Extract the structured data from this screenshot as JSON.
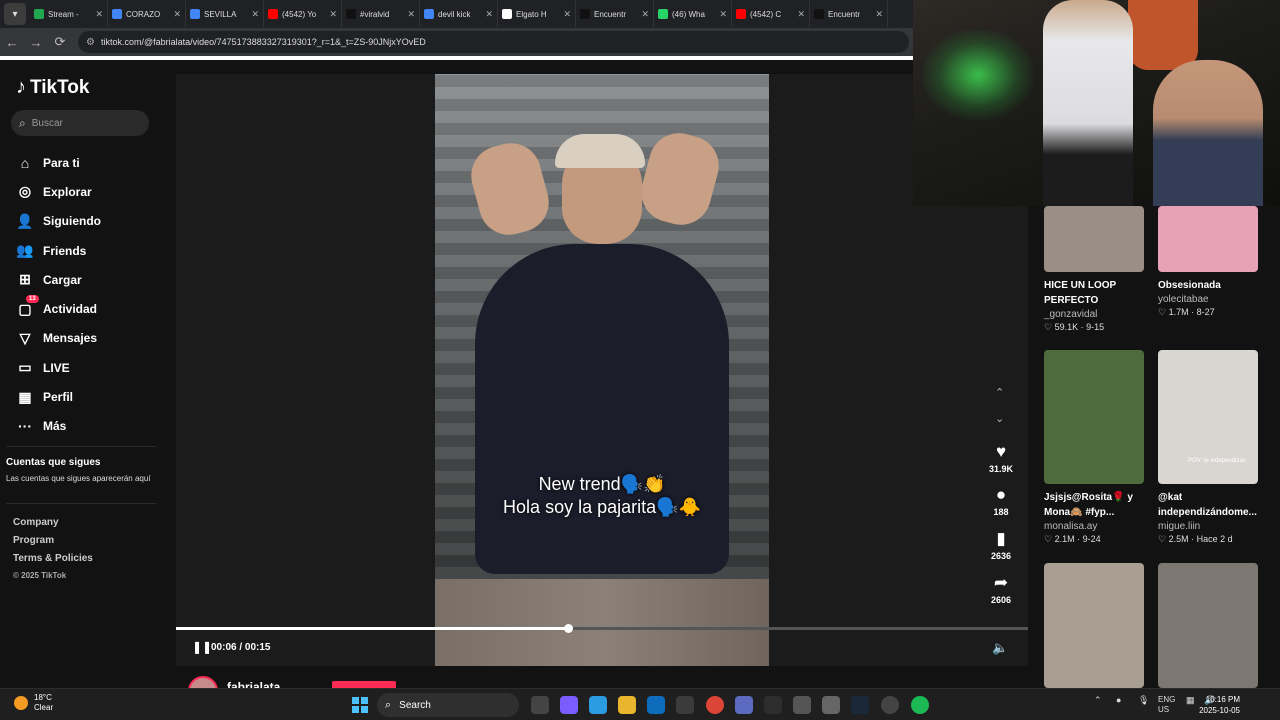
{
  "browser": {
    "tabs": [
      {
        "label": "Stream -",
        "color": "#1fa84f"
      },
      {
        "label": "CORAZO",
        "color": "#4285f4"
      },
      {
        "label": "SEVILLA",
        "color": "#4285f4"
      },
      {
        "label": "(4542) Yo",
        "color": "#ff0000"
      },
      {
        "label": "#viralvid",
        "color": "#111111"
      },
      {
        "label": "devil kick",
        "color": "#4285f4"
      },
      {
        "label": "Elgato H",
        "color": "#ffffff"
      },
      {
        "label": "Encuentr",
        "color": "#111111"
      },
      {
        "label": "(46) Wha",
        "color": "#25d366"
      },
      {
        "label": "(4542) C",
        "color": "#ff0000"
      },
      {
        "label": "Encuentr",
        "color": "#111111"
      }
    ],
    "url": "tiktok.com/@fabrialata/video/7475173883327319301?_r=1&_t=ZS-90JNjxYOvED"
  },
  "sidebar": {
    "logo": "TikTok",
    "search_placeholder": "Buscar",
    "items": [
      {
        "label": "Para ti",
        "icon": "home-icon"
      },
      {
        "label": "Explorar",
        "icon": "compass-icon"
      },
      {
        "label": "Siguiendo",
        "icon": "person-icon"
      },
      {
        "label": "Friends",
        "icon": "friends-icon"
      },
      {
        "label": "Cargar",
        "icon": "upload-icon"
      },
      {
        "label": "Actividad",
        "icon": "inbox-icon",
        "badge": "13"
      },
      {
        "label": "Mensajes",
        "icon": "send-icon"
      },
      {
        "label": "LIVE",
        "icon": "live-icon"
      },
      {
        "label": "Perfil",
        "icon": "profile-icon"
      },
      {
        "label": "Más",
        "icon": "more-icon"
      }
    ],
    "following_title": "Cuentas que sigues",
    "following_note": "Las cuentas que sigues aparecerán aquí",
    "footer": [
      "Company",
      "Program",
      "Terms & Policies"
    ],
    "copyright": "© 2025 TikTok"
  },
  "player": {
    "caption_line1": "New trend🗣️👏",
    "caption_line2": "Hola soy la pajarita🗣️🐥",
    "time": "00:06 / 00:15",
    "progress": 0.46,
    "likes": "31.9K",
    "comments": "188",
    "saves": "2636",
    "shares": "2606",
    "username": "fabrialata"
  },
  "feed": [
    {
      "title": "HICE UN LOOP PERFECTO",
      "user": "_gonzavidal",
      "stats": "♡ 59.1K · 9-15",
      "thumb_color": "#9a8f86"
    },
    {
      "title": "Obsesionada",
      "user": "yolecitabae",
      "stats": "♡ 1.7M · 8-27",
      "thumb_color": "#e7a2b8"
    },
    {
      "title": "Jsjsjs@Rosita🌹 y Mona🙈 #fyp...",
      "user": "monalisa.ay",
      "stats": "♡ 2.1M · 9-24",
      "thumb_color": "#4d6b3c"
    },
    {
      "title": "@kat independizándome...",
      "user": "migue.liin",
      "stats": "♡ 2.5M · Hace 2 d",
      "thumb_color": "#d9d6d2",
      "overlay": "POV: te independizas"
    },
    {
      "title": "",
      "user": "",
      "stats": "",
      "thumb_color": "#a89f92"
    },
    {
      "title": "",
      "user": "",
      "stats": "",
      "thumb_color": "#7d7771"
    }
  ],
  "taskbar": {
    "temp": "18°C",
    "weather": "Clear",
    "search": "Search",
    "lang1": "ENG",
    "lang2": "US",
    "time": "10:16 PM",
    "date": "2025-10-05"
  }
}
